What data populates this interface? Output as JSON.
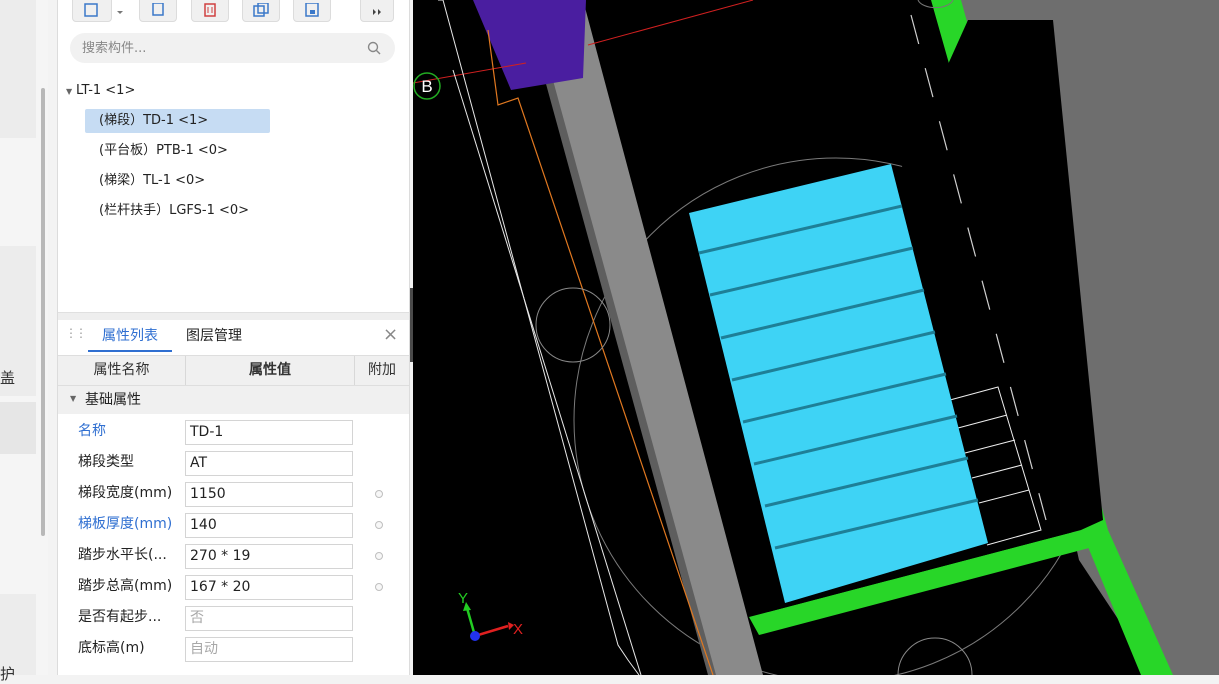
{
  "left_strip": {
    "text1": "盖",
    "text2": "护"
  },
  "toolbar": {
    "buttons": [
      {
        "icon": "new-component-icon"
      },
      {
        "icon": "dropdown-arrow-icon"
      },
      {
        "icon": "copy-icon"
      },
      {
        "icon": "delete-icon"
      },
      {
        "icon": "duplicate-layer-icon"
      },
      {
        "icon": "save-icon"
      },
      {
        "icon": "more-icon"
      }
    ]
  },
  "search": {
    "placeholder": "搜索构件..."
  },
  "tree": {
    "root": "LT-1 <1>",
    "items": [
      {
        "label": "(梯段）TD-1 <1>",
        "selected": true
      },
      {
        "label": "(平台板）PTB-1 <0>",
        "selected": false
      },
      {
        "label": "(梯梁）TL-1 <0>",
        "selected": false
      },
      {
        "label": "(栏杆扶手）LGFS-1 <0>",
        "selected": false
      }
    ]
  },
  "props": {
    "tabs": [
      "属性列表",
      "图层管理"
    ],
    "columns": {
      "name": "属性名称",
      "value": "属性值",
      "extra": "附加"
    },
    "group": "基础属性",
    "rows": [
      {
        "name": "名称",
        "value": "TD-1",
        "blue": true,
        "dot": false,
        "dim": false
      },
      {
        "name": "梯段类型",
        "value": "AT",
        "blue": false,
        "dot": false,
        "dim": false
      },
      {
        "name": "梯段宽度(mm)",
        "value": "1150",
        "blue": false,
        "dot": true,
        "dim": false
      },
      {
        "name": "梯板厚度(mm)",
        "value": "140",
        "blue": true,
        "dot": true,
        "dim": false
      },
      {
        "name": "踏步水平长(...",
        "value": "270 * 19",
        "blue": false,
        "dot": true,
        "dim": false
      },
      {
        "name": "踏步总高(mm)",
        "value": "167 * 20",
        "blue": false,
        "dot": true,
        "dim": false
      },
      {
        "name": "是否有起步...",
        "value": "否",
        "blue": false,
        "dot": false,
        "dim": true
      },
      {
        "name": "底标高(m)",
        "value": "自动",
        "blue": false,
        "dot": false,
        "dim": true
      }
    ]
  },
  "viewport": {
    "axis_marker": "B",
    "axis_x": "X",
    "axis_y": "Y",
    "colors": {
      "stair": "#3ed3f5",
      "slab": "#28d628",
      "wall": "#8a8a8a",
      "background": "#000000"
    }
  }
}
